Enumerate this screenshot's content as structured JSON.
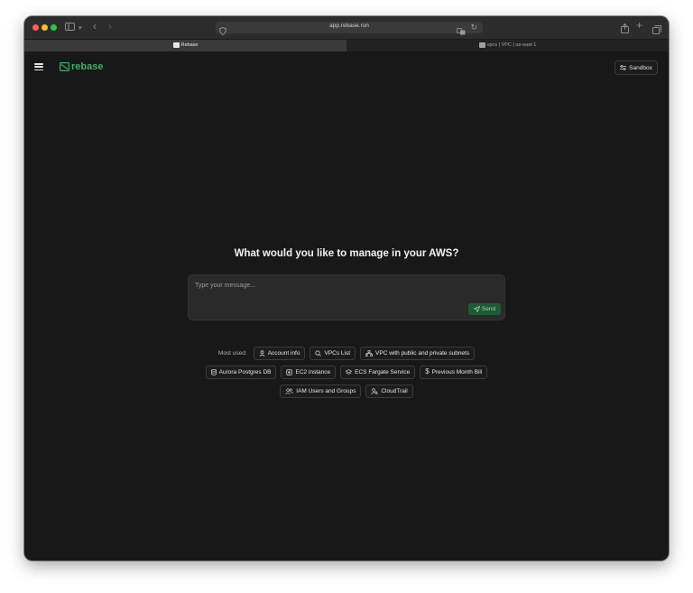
{
  "browser": {
    "url": "app.rebase.run",
    "tabs": [
      {
        "label": "Rebase",
        "active": true
      },
      {
        "label": "vpcs | VPC | us-east-1",
        "active": false
      }
    ]
  },
  "app": {
    "logo_text": "rebase",
    "environment_button": "Sandbox",
    "prompt_heading": "What would you like to manage in your AWS?",
    "message_placeholder": "Type your message...",
    "send_label": "Send",
    "most_used_label": "Most used:",
    "shortcuts": [
      {
        "label": "Account info",
        "icon": "user-icon"
      },
      {
        "label": "VPCs List",
        "icon": "search-icon"
      },
      {
        "label": "VPC with public and private subnets",
        "icon": "network-icon"
      },
      {
        "label": "Aurora Postgres DB",
        "icon": "database-icon"
      },
      {
        "label": "EC2 instance",
        "icon": "chip-icon"
      },
      {
        "label": "ECS Fargate Service",
        "icon": "layers-icon"
      },
      {
        "label": "Previous Month Bill",
        "icon": "dollar-icon"
      },
      {
        "label": "IAM Users and Groups",
        "icon": "users-icon"
      },
      {
        "label": "CloudTrail",
        "icon": "user-search-icon"
      }
    ]
  },
  "colors": {
    "brand_green": "#3fae6a",
    "send_bg": "#1f5a37",
    "page_bg": "#181818"
  }
}
